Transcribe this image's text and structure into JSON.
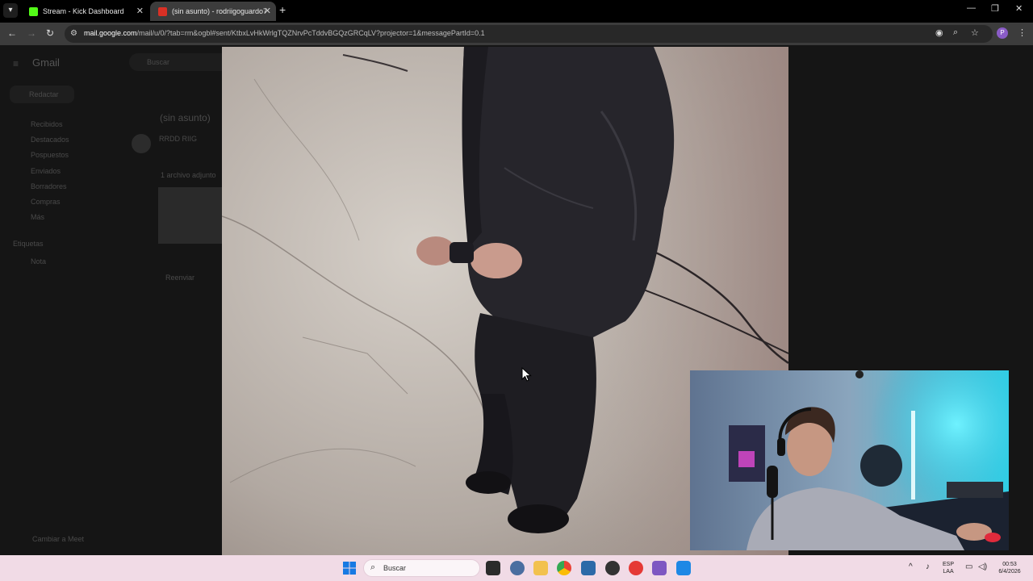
{
  "browser": {
    "tabs": [
      {
        "title": "Stream - Kick Dashboard",
        "favicon_color": "#53fc18",
        "active": false
      },
      {
        "title": "(sin asunto) - rodriigoguardo7",
        "favicon_color": "#d93025",
        "active": true
      }
    ],
    "url_domain": "mail.google.com",
    "url_path": "/mail/u/0/?tab=rm&ogbl#sent/KtbxLvHkWrlgTQZNrvPcTddvBGQzGRCqLV?projector=1&messagePartId=0.1",
    "profile_initial": "P"
  },
  "gmail": {
    "logo": "Gmail",
    "search_placeholder": "Buscar",
    "compose": "Redactar",
    "subject": "(sin asunto)",
    "sender": "RRDD RIIG",
    "nav": [
      "Recibidos",
      "Destacados",
      "Pospuestos",
      "Enviados",
      "Borradores",
      "Compras",
      "Más"
    ],
    "labels_title": "Etiquetas",
    "label_item": "Nota",
    "attachment_note": "1 archivo adjunto",
    "forward": "Reenviar",
    "bottom_link": "Cambiar a Meet"
  },
  "taskbar": {
    "search_label": "Buscar",
    "lang_top": "ESP",
    "lang_bottom": "LAA",
    "time": "00:53",
    "date": "6/4/2026"
  },
  "colors": {
    "accent_kick": "#53fc18",
    "taskbar_bg": "#f1dbe6",
    "profile": "#8a5cc7"
  }
}
